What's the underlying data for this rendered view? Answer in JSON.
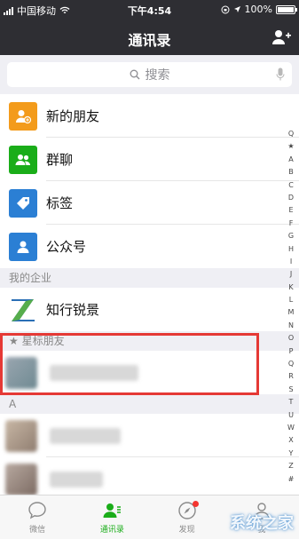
{
  "status": {
    "carrier": "中国移动",
    "time": "下午4:54",
    "battery": "100%",
    "battery_level": 1.0
  },
  "nav": {
    "title": "通讯录"
  },
  "search": {
    "placeholder": "搜索"
  },
  "entries": [
    {
      "label": "新的朋友",
      "icon": "new-friends-icon",
      "color": "#f39b1b"
    },
    {
      "label": "群聊",
      "icon": "group-chat-icon",
      "color": "#1aad19"
    },
    {
      "label": "标签",
      "icon": "tag-icon",
      "color": "#2b7fd4"
    },
    {
      "label": "公众号",
      "icon": "official-account-icon",
      "color": "#2b7fd4"
    }
  ],
  "enterprise": {
    "header": "我的企业",
    "name": "知行锐景"
  },
  "starred": {
    "header": "星标朋友"
  },
  "section_a": {
    "header": "A"
  },
  "index": [
    "Q",
    "★",
    "A",
    "B",
    "C",
    "D",
    "E",
    "F",
    "G",
    "H",
    "I",
    "J",
    "K",
    "L",
    "M",
    "N",
    "O",
    "P",
    "Q",
    "R",
    "S",
    "T",
    "U",
    "W",
    "X",
    "Y",
    "Z",
    "#"
  ],
  "tabs": [
    {
      "label": "微信",
      "icon": "chat-icon"
    },
    {
      "label": "通讯录",
      "icon": "contacts-icon",
      "active": true
    },
    {
      "label": "发现",
      "icon": "discover-icon"
    },
    {
      "label": "我",
      "icon": "me-icon"
    }
  ],
  "watermark": "系统之家",
  "colors": {
    "accent": "#1aad19",
    "highlight": "#e53935",
    "navbar": "#2e2e33"
  }
}
